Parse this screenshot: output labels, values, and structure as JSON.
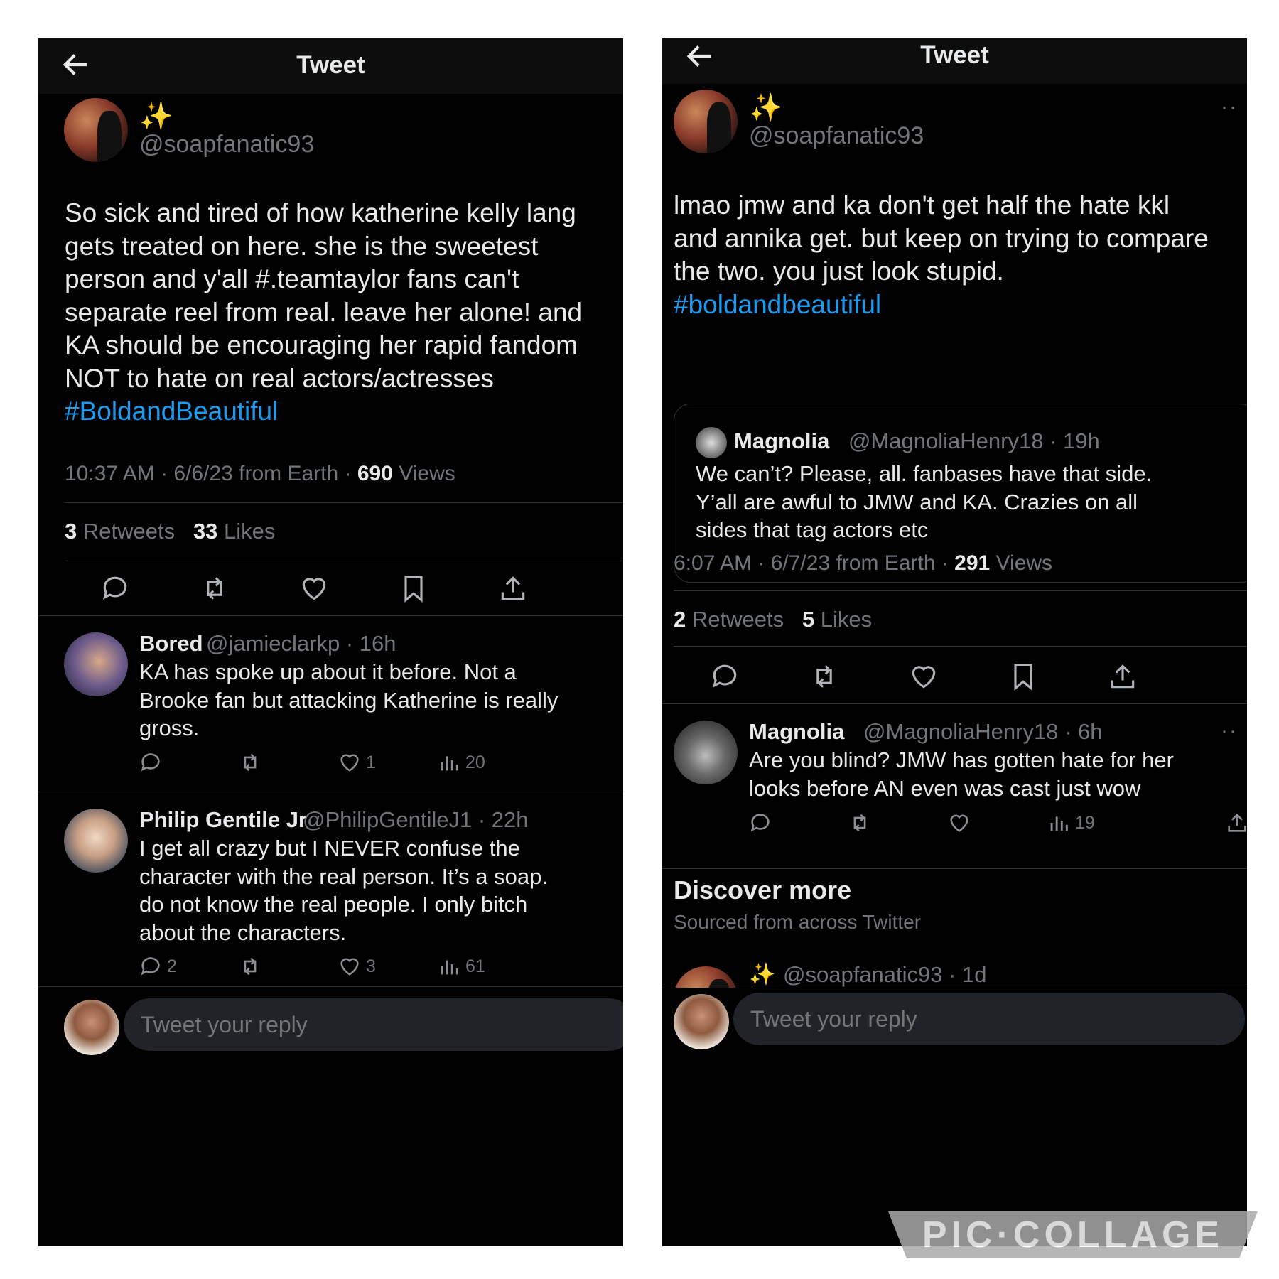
{
  "left": {
    "header": {
      "title": "Tweet"
    },
    "tweet": {
      "name_emoji": "✨",
      "handle": "@soapfanatic93",
      "text_lines": [
        "So sick and tired of how katherine kelly lang",
        "gets treated on here. she is the sweetest",
        "person and y'all #.teamtaylor fans can't",
        "separate reel from real. leave her alone! and",
        "KA should be encouraging her rapid fandom",
        "NOT to hate on real actors/actresses"
      ],
      "hashtag": "#BoldandBeautiful",
      "meta_time": "10:37 AM · 6/6/23 from Earth · ",
      "views_count": "690",
      "views_label": " Views",
      "retweets_count": "3",
      "retweets_label": " Retweets",
      "likes_count": "33",
      "likes_label": " Likes"
    },
    "replies": [
      {
        "name": "Bored",
        "handle": "@jamieclarkp · 16h",
        "lines": [
          "KA has spoke up about it before.  Not a",
          "Brooke fan but attacking Katherine is really",
          "gross."
        ],
        "likes": "1",
        "views": "20"
      },
      {
        "name": "Philip Gentile Jr",
        "handle": "@PhilipGentileJ1 · 22h",
        "lines": [
          "I get all crazy but I NEVER confuse the",
          "character with the real person. It’s a soap.",
          "do not know the real people. I only bitch",
          "about the characters."
        ],
        "replies": "2",
        "likes": "3",
        "views": "61"
      }
    ],
    "reply_placeholder": "Tweet your reply"
  },
  "right": {
    "header": {
      "title": "Tweet"
    },
    "tweet": {
      "name_emoji": "✨",
      "handle": "@soapfanatic93",
      "text_lines": [
        "lmao jmw and ka don't get half the hate kkl",
        "and annika get. but keep on trying to compare",
        "the two. you just look stupid."
      ],
      "hashtag": "#boldandbeautiful",
      "quote": {
        "name": "Magnolia",
        "handle": "@MagnoliaHenry18 · 19h",
        "lines": [
          "We can’t? Please, all. fanbases have that side.",
          "Y’all are awful to JMW and KA.  Crazies on all",
          "sides that tag actors etc"
        ]
      },
      "meta_time": "6:07 AM · 6/7/23 from Earth · ",
      "views_count": "291",
      "views_label": " Views",
      "retweets_count": "2",
      "retweets_label": " Retweets",
      "likes_count": "5",
      "likes_label": " Likes"
    },
    "replies": [
      {
        "name": "Magnolia",
        "handle": "@MagnoliaHenry18 · 6h",
        "lines": [
          "Are you blind? JMW has gotten hate for her",
          "looks before AN even was cast just wow"
        ],
        "views": "19"
      }
    ],
    "discover": {
      "title": "Discover more",
      "subtitle": "Sourced from across Twitter",
      "next_handle": "@soapfanatic93 · 1d"
    },
    "reply_placeholder": "Tweet your reply"
  },
  "watermark": "PIC·COLLAGE",
  "colors": {
    "background": "#000000",
    "link": "#1d9bf0",
    "muted": "#71767b",
    "text": "#e7e9ea"
  }
}
